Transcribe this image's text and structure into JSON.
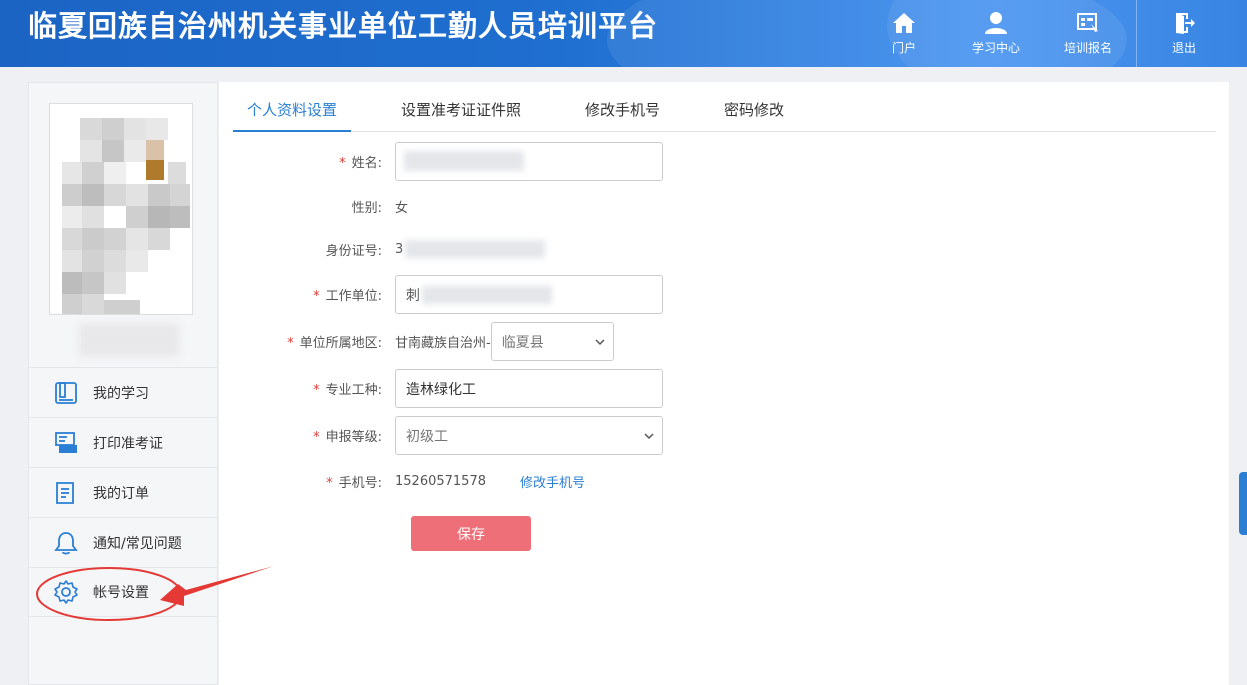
{
  "header": {
    "title": "临夏回族自治州机关事业单位工勤人员培训平台",
    "nav": [
      {
        "label": "门户",
        "icon": "home-icon"
      },
      {
        "label": "学习中心",
        "icon": "user-icon"
      },
      {
        "label": "培训报名",
        "icon": "signup-icon"
      },
      {
        "label": "退出",
        "icon": "logout-icon"
      }
    ]
  },
  "sidebar": {
    "items": [
      {
        "label": "我的学习",
        "icon": "book-icon"
      },
      {
        "label": "打印准考证",
        "icon": "printer-icon"
      },
      {
        "label": "我的订单",
        "icon": "order-icon"
      },
      {
        "label": "通知/常见问题",
        "icon": "bell-icon"
      },
      {
        "label": "帐号设置",
        "icon": "gear-icon"
      }
    ]
  },
  "tabs": [
    "个人资料设置",
    "设置准考证证件照",
    "修改手机号",
    "密码修改"
  ],
  "form": {
    "name_label": "姓名:",
    "gender_label": "性别:",
    "gender_value": "女",
    "id_label": "身份证号:",
    "id_value_prefix": "3",
    "unit_label": "工作单位:",
    "unit_value_prefix": "刺",
    "region_label": "单位所属地区:",
    "region_prefix": "甘南藏族自治州-",
    "region_county": "临夏县",
    "trade_label": "专业工种:",
    "trade_value": "造林绿化工",
    "level_label": "申报等级:",
    "level_value": "初级工",
    "phone_label": "手机号:",
    "phone_value": "15260571578",
    "change_phone_link": "修改手机号",
    "required_mark": "*"
  },
  "save_label": "保存",
  "colors": {
    "accent": "#2a7fd4",
    "save": "#ef6f78",
    "annotation": "#e53935"
  }
}
